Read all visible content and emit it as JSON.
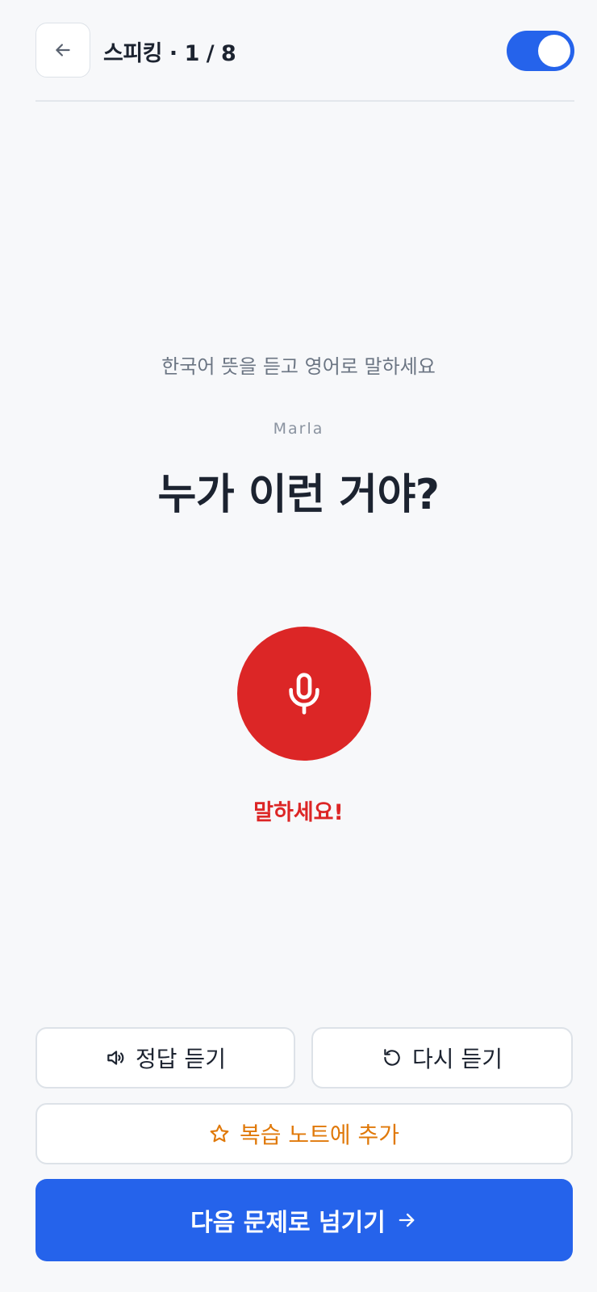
{
  "header": {
    "title": "스피킹 · 1 / 8",
    "back_icon": "arrow-left-icon",
    "toggle_on": true
  },
  "prompt": {
    "instruction": "한국어 뜻을 듣고 영어로 말하세요",
    "speaker": "Marla",
    "sentence": "누가 이런 거야?"
  },
  "mic": {
    "icon": "microphone-icon",
    "status": "말하세요!"
  },
  "actions": {
    "answer_label": "정답 듣기",
    "answer_icon": "speaker-icon",
    "replay_label": "다시 듣기",
    "replay_icon": "replay-icon",
    "review_label": "복습 노트에 추가",
    "review_icon": "star-icon",
    "next_label": "다음 문제로 넘기기",
    "next_icon": "arrow-right-icon"
  },
  "colors": {
    "accent": "#2563eb",
    "record": "#dc2626",
    "review": "#e0790a",
    "background": "#f7f8fa"
  }
}
